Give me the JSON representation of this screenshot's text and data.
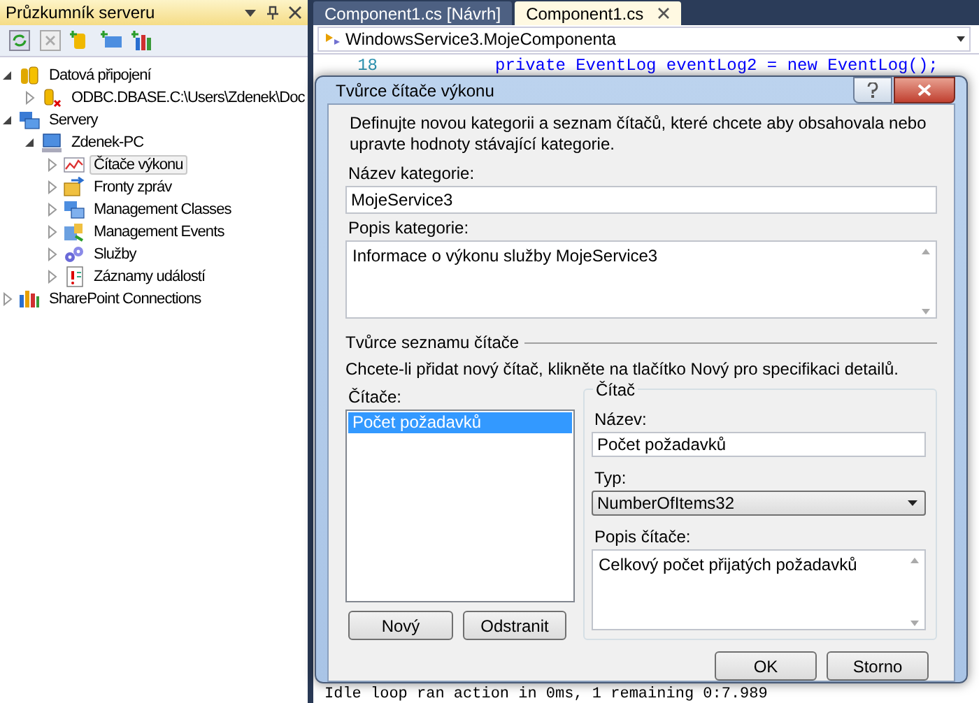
{
  "explorer": {
    "title": "Průzkumník serveru",
    "tree": [
      {
        "label": "Datová připojení",
        "kind": "database",
        "expanded": true,
        "selected": false,
        "children": [
          {
            "label": "ODBC.DBASE.C:\\Users\\Zdenek\\Doc",
            "kind": "connection",
            "expanded": false,
            "selected": false
          }
        ]
      },
      {
        "label": "Servery",
        "kind": "servers",
        "expanded": true,
        "selected": false,
        "children": [
          {
            "label": "Zdenek-PC",
            "kind": "computer",
            "expanded": true,
            "selected": false,
            "children": [
              {
                "label": "Čítače výkonu",
                "kind": "counters",
                "expanded": false,
                "selected": true
              },
              {
                "label": "Fronty zpráv",
                "kind": "queue",
                "expanded": false,
                "selected": false
              },
              {
                "label": "Management Classes",
                "kind": "classes",
                "expanded": false,
                "selected": false
              },
              {
                "label": "Management Events",
                "kind": "events",
                "expanded": false,
                "selected": false
              },
              {
                "label": "Služby",
                "kind": "services",
                "expanded": false,
                "selected": false
              },
              {
                "label": "Záznamy událostí",
                "kind": "log",
                "expanded": false,
                "selected": false
              }
            ]
          }
        ]
      },
      {
        "label": "SharePoint Connections",
        "kind": "sharepoint",
        "expanded": false,
        "selected": false
      }
    ]
  },
  "editor": {
    "tabs": [
      {
        "label": "Component1.cs [Návrh]",
        "selected": false
      },
      {
        "label": "Component1.cs",
        "selected": true
      }
    ],
    "type_combo": "WindowsService3.MojeComponenta",
    "code": [
      {
        "number": "18",
        "text": "private EventLog eventLog2 = new EventLog();"
      }
    ],
    "output_line": "Idle loop ran action in 0ms, 1 remaining 0:7.989"
  },
  "dialog": {
    "title": "Tvůrce čítače výkonu",
    "description": "Definujte novou kategorii a seznam čítačů, které chcete aby obsahovala nebo upravte hodnoty stávající kategorie.",
    "category_name": {
      "label": "Název kategorie:",
      "value": "MojeService3"
    },
    "category_description": {
      "label": "Popis kategorie:",
      "value": "Informace o výkonu služby MojeService3"
    },
    "counter_list_section": {
      "title": "Tvůrce seznamu čítače",
      "hint": "Chcete-li přidat nový čítač, klikněte na tlačítko Nový pro specifikaci detailů."
    },
    "counters": {
      "label": "Čítače:",
      "items": [
        {
          "label": "Počet požadavků",
          "selected": true
        }
      ]
    },
    "list_buttons": [
      "Nový",
      "Odstranit"
    ],
    "counter": {
      "title": "Čítač",
      "name": {
        "label": "Název:",
        "value": "Počet požadavků"
      },
      "type": {
        "label": "Typ:",
        "value": "NumberOfItems32"
      },
      "description": {
        "label": "Popis čítače:",
        "value": "Celkový počet přijatých požadavků"
      }
    },
    "buttons": [
      "OK",
      "Storno"
    ]
  }
}
